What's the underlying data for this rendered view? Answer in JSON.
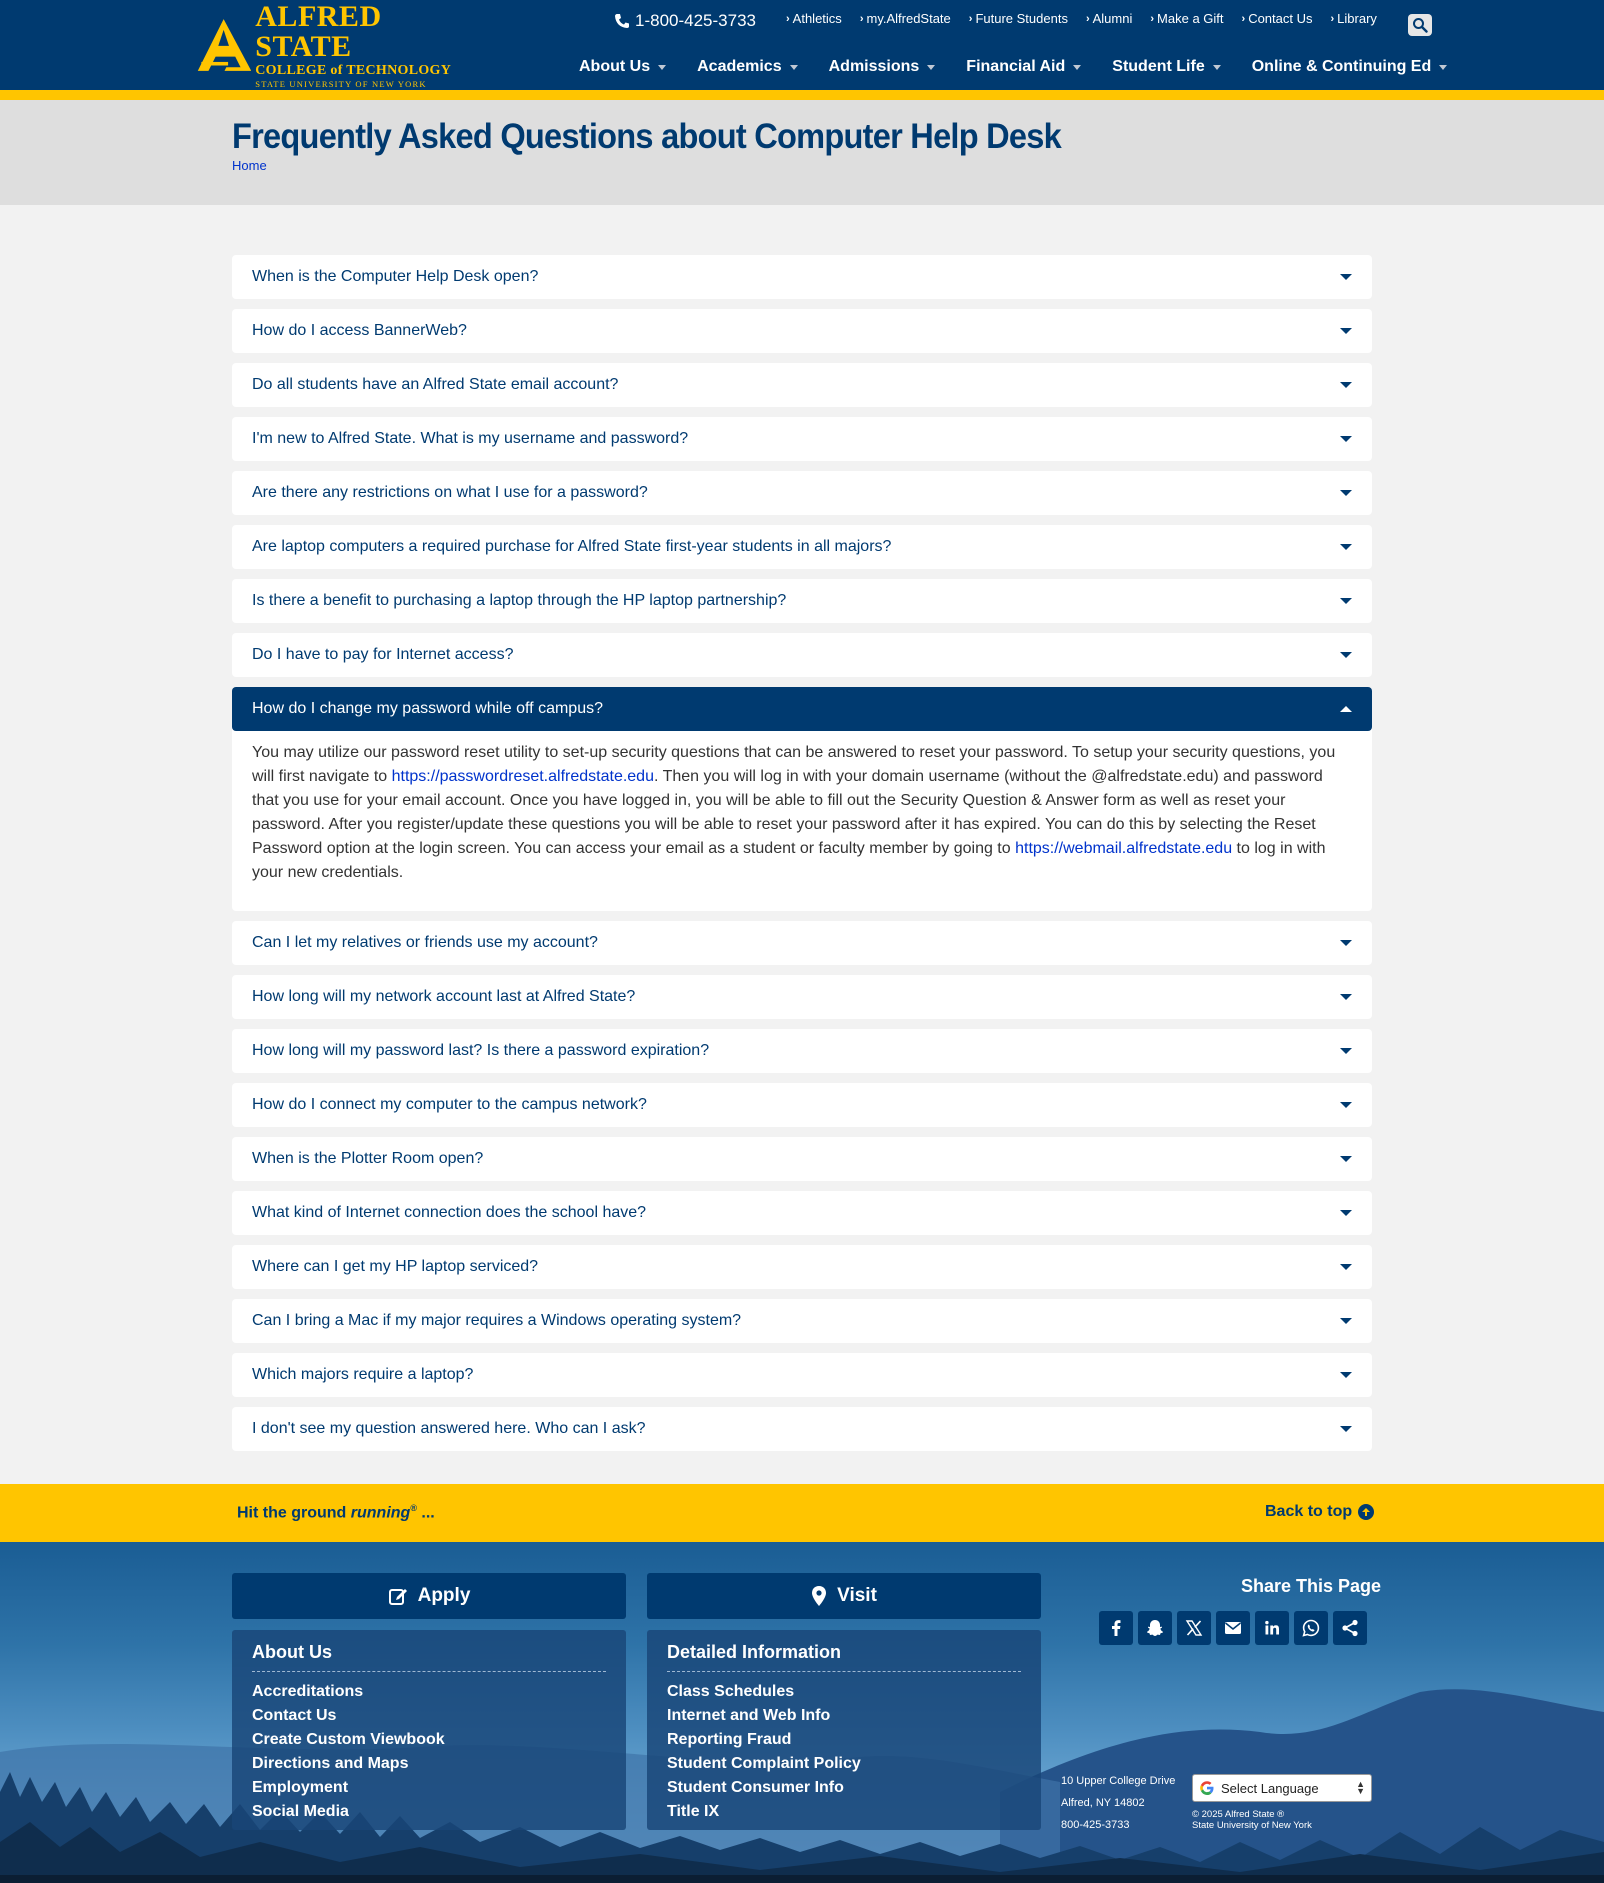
{
  "header": {
    "logo": {
      "line1": "ALFRED STATE",
      "line2": "COLLEGE of TECHNOLOGY",
      "line3": "STATE UNIVERSITY OF NEW YORK"
    },
    "phone": "1-800-425-3733",
    "utility_links": [
      "Athletics",
      "my.AlfredState",
      "Future Students",
      "Alumni",
      "Make a Gift",
      "Contact Us",
      "Library"
    ],
    "main_nav": [
      "About Us",
      "Academics",
      "Admissions",
      "Financial Aid",
      "Student Life",
      "Online & Continuing Ed"
    ]
  },
  "page": {
    "title": "Frequently Asked Questions about Computer Help Desk",
    "breadcrumb": "Home"
  },
  "faq": {
    "items": [
      {
        "q": "When is the Computer Help Desk open?"
      },
      {
        "q": "How do I access BannerWeb?"
      },
      {
        "q": "Do all students have an Alfred State email account?"
      },
      {
        "q": "I'm new to Alfred State. What is my username and password?"
      },
      {
        "q": "Are there any restrictions on what I use for a password?"
      },
      {
        "q": "Are laptop computers a required purchase for Alfred State first-year students in all majors?"
      },
      {
        "q": "Is there a benefit to purchasing a laptop through the HP laptop partnership?"
      },
      {
        "q": "Do I have to pay for Internet access?"
      },
      {
        "q": "How do I change my password while off campus?"
      },
      {
        "q": "Can I let my relatives or friends use my account?"
      },
      {
        "q": "How long will my network account last at Alfred State?"
      },
      {
        "q": "How long will my password last? Is there a password expiration?"
      },
      {
        "q": "How do I connect my computer to the campus network?"
      },
      {
        "q": "When is the Plotter Room open?"
      },
      {
        "q": "What kind of Internet connection does the school have?"
      },
      {
        "q": "Where can I get my HP laptop serviced?"
      },
      {
        "q": "Can I bring a Mac if my major requires a Windows operating system?"
      },
      {
        "q": "Which majors require a laptop?"
      },
      {
        "q": "I don't see my question answered here. Who can I ask?"
      }
    ],
    "open_answer": {
      "text1": "You may utilize our password reset utility to set-up security questions that can be answered to reset your password. To setup your security questions, you will first navigate to ",
      "link1": "https://passwordreset.alfredstate.edu",
      "text2": ". Then you will log in with your domain username (without the @alfredstate.edu) and password that you use for your email account. Once you have logged in, you will be able to fill out the Security Question & Answer form as well as reset your password. After you register/update these questions you will be able to reset your password after it has expired. You can do this by selecting the Reset Password option at the login screen. You can access your email as a student or faculty member by going to ",
      "link2": "https://webmail.alfredstate.edu",
      "text3": " to log in with your new credentials."
    }
  },
  "band": {
    "tagline_pre": "Hit the ground ",
    "tagline_em": "running",
    "tagline_mark": "®",
    "tagline_post": " ...",
    "back_to_top": "Back to top"
  },
  "footer": {
    "apply_label": "Apply",
    "visit_label": "Visit",
    "about": {
      "title": "About Us",
      "links": [
        "Accreditations",
        "Contact Us",
        "Create Custom Viewbook",
        "Directions and Maps",
        "Employment",
        "Social Media"
      ]
    },
    "detailed": {
      "title": "Detailed Information",
      "links": [
        "Class Schedules",
        "Internet and Web Info",
        "Reporting Fraud",
        "Student Complaint Policy",
        "Student Consumer Info",
        "Title IX"
      ]
    },
    "share_title": "Share This Page",
    "share_icons": [
      "facebook-icon",
      "snapchat-icon",
      "x-icon",
      "email-icon",
      "linkedin-icon",
      "whatsapp-icon",
      "share-icon"
    ],
    "address": [
      "10 Upper College Drive",
      "Alfred, NY 14802",
      "800-425-3733"
    ],
    "language_select": "Select Language",
    "copyright_line1": "© 2025 Alfred State ®",
    "copyright_line2": "State University of New York"
  },
  "colors": {
    "brand_blue": "#003a70",
    "brand_gold": "#ffc500",
    "link_blue": "#0033cc"
  }
}
